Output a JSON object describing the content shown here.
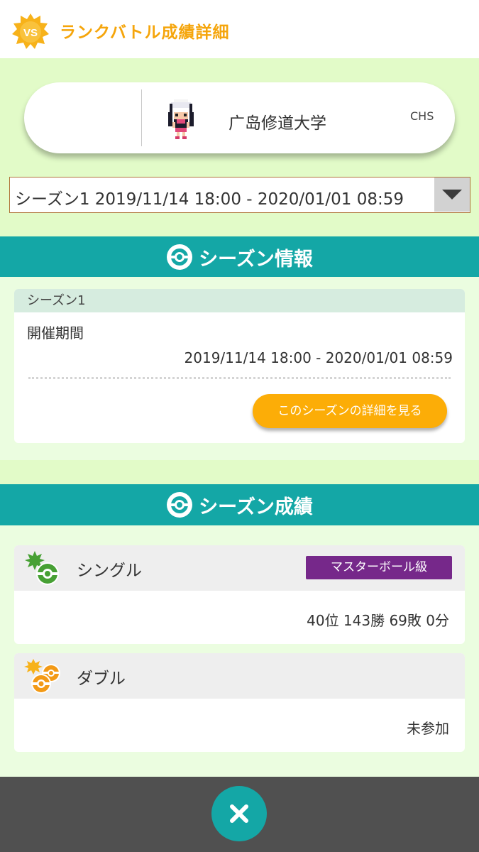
{
  "header": {
    "title": "ランクバトル成績詳細",
    "badge_text": "VS"
  },
  "profile": {
    "name": "广岛修道大学",
    "code": "CHS"
  },
  "season_select": {
    "selected": "シーズン1 2019/11/14 18:00 - 2020/01/01 08:59"
  },
  "season_info": {
    "section_title": "シーズン情報",
    "card_title": "シーズン1",
    "period_label": "開催期間",
    "period_value": "2019/11/14 18:00 - 2020/01/01 08:59",
    "detail_button": "このシーズンの詳細を見る"
  },
  "season_results": {
    "section_title": "シーズン成績",
    "single": {
      "label": "シングル",
      "rank": "マスターボール級",
      "record": "40位 143勝 69敗 0分"
    },
    "double": {
      "label": "ダブル",
      "record": "未参加"
    }
  },
  "colors": {
    "accent": "#f5a50b",
    "teal": "#14a7a6",
    "master_ball": "#76288a",
    "button": "#fcad07"
  }
}
